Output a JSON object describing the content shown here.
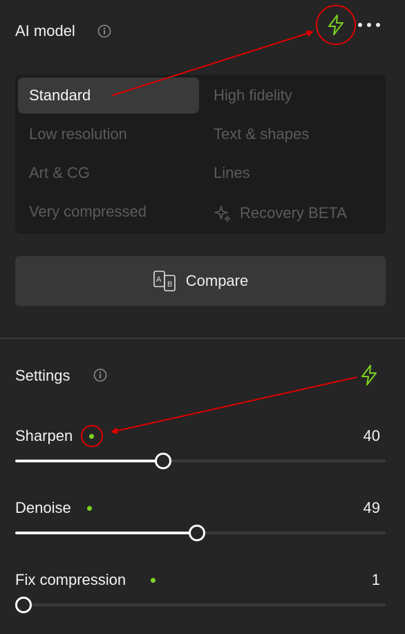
{
  "ai_model": {
    "title": "AI model",
    "models": [
      {
        "label": "Standard",
        "selected": true
      },
      {
        "label": "High fidelity",
        "selected": false
      },
      {
        "label": "Low resolution",
        "selected": false
      },
      {
        "label": "Text & shapes",
        "selected": false
      },
      {
        "label": "Art & CG",
        "selected": false
      },
      {
        "label": "Lines",
        "selected": false
      },
      {
        "label": "Very compressed",
        "selected": false
      },
      {
        "label": "Recovery BETA",
        "selected": false,
        "icon": "sparkle-icon"
      }
    ],
    "compare_label": "Compare",
    "compare_icon": "ab-compare-icon"
  },
  "settings": {
    "title": "Settings",
    "sliders": [
      {
        "label": "Sharpen",
        "value": "40",
        "fraction": 0.4
      },
      {
        "label": "Denoise",
        "value": "49",
        "fraction": 0.49
      },
      {
        "label": "Fix compression",
        "value": "1",
        "fraction": 0.0
      }
    ]
  },
  "colors": {
    "accent_green": "#7ed321",
    "annotation_red": "#e00000",
    "background": "#252525"
  },
  "icons": [
    "info-icon",
    "lightning-bolt-icon",
    "more-options-icon",
    "sparkle-icon",
    "ab-compare-icon"
  ]
}
